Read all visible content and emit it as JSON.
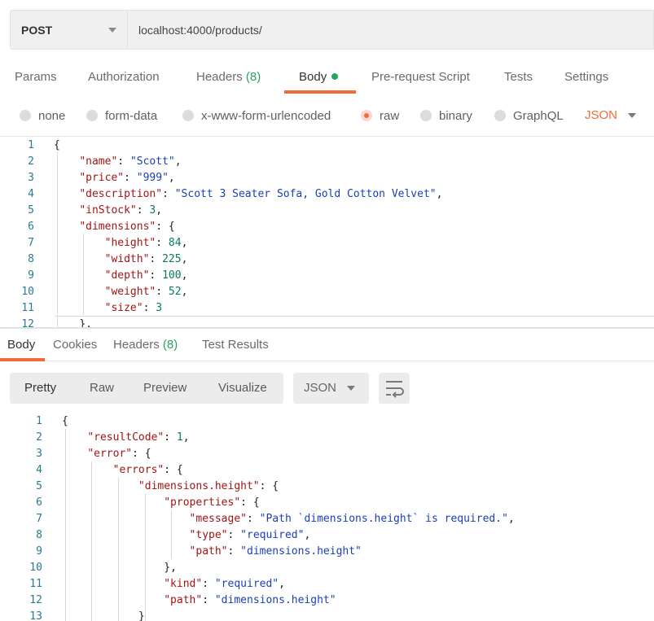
{
  "request": {
    "method": "POST",
    "url": "localhost:4000/products/"
  },
  "request_tabs": [
    {
      "label": "Params"
    },
    {
      "label": "Authorization"
    },
    {
      "label": "Headers",
      "count": "(8)"
    },
    {
      "label": "Body"
    },
    {
      "label": "Pre-request Script"
    },
    {
      "label": "Tests"
    },
    {
      "label": "Settings"
    }
  ],
  "body_types": [
    "none",
    "form-data",
    "x-www-form-urlencoded",
    "raw",
    "binary",
    "GraphQL"
  ],
  "selected_body_type": "raw",
  "body_format": "JSON",
  "request_body_lines": [
    {
      "n": "1",
      "code": "{"
    },
    {
      "n": "2",
      "code": "    \"name\": \"Scott\","
    },
    {
      "n": "3",
      "code": "    \"price\": \"999\","
    },
    {
      "n": "4",
      "code": "    \"description\": \"Scott 3 Seater Sofa, Gold Cotton Velvet\","
    },
    {
      "n": "5",
      "code": "    \"inStock\": 3,"
    },
    {
      "n": "6",
      "code": "    \"dimensions\": {"
    },
    {
      "n": "7",
      "code": "        \"height\": 84,"
    },
    {
      "n": "8",
      "code": "        \"width\": 225,"
    },
    {
      "n": "9",
      "code": "        \"depth\": 100,"
    },
    {
      "n": "10",
      "code": "        \"weight\": 52,"
    },
    {
      "n": "11",
      "code": "        \"size\": 3"
    },
    {
      "n": "12",
      "code": "    },"
    }
  ],
  "response_tabs": [
    {
      "label": "Body"
    },
    {
      "label": "Cookies"
    },
    {
      "label": "Headers",
      "count": "(8)"
    },
    {
      "label": "Test Results"
    }
  ],
  "response_views": [
    "Pretty",
    "Raw",
    "Preview",
    "Visualize"
  ],
  "response_format": "JSON",
  "response_body_lines": [
    {
      "n": "1",
      "code": "{"
    },
    {
      "n": "2",
      "code": "    \"resultCode\": 1,"
    },
    {
      "n": "3",
      "code": "    \"error\": {"
    },
    {
      "n": "4",
      "code": "        \"errors\": {"
    },
    {
      "n": "5",
      "code": "            \"dimensions.height\": {"
    },
    {
      "n": "6",
      "code": "                \"properties\": {"
    },
    {
      "n": "7",
      "code": "                    \"message\": \"Path `dimensions.height` is required.\","
    },
    {
      "n": "8",
      "code": "                    \"type\": \"required\","
    },
    {
      "n": "9",
      "code": "                    \"path\": \"dimensions.height\""
    },
    {
      "n": "10",
      "code": "                },"
    },
    {
      "n": "11",
      "code": "                \"kind\": \"required\","
    },
    {
      "n": "12",
      "code": "                \"path\": \"dimensions.height\""
    },
    {
      "n": "13",
      "code": "            }"
    }
  ],
  "colors": {
    "accent": "#f26b3a",
    "success": "#26a65b",
    "json_key": "#a31515",
    "json_string": "#1a3fb5",
    "json_number": "#0a7a5e",
    "line_number": "#2b7a91"
  },
  "icons": {
    "wrap": "wrap-lines-icon",
    "caret": "chevron-down-icon"
  }
}
